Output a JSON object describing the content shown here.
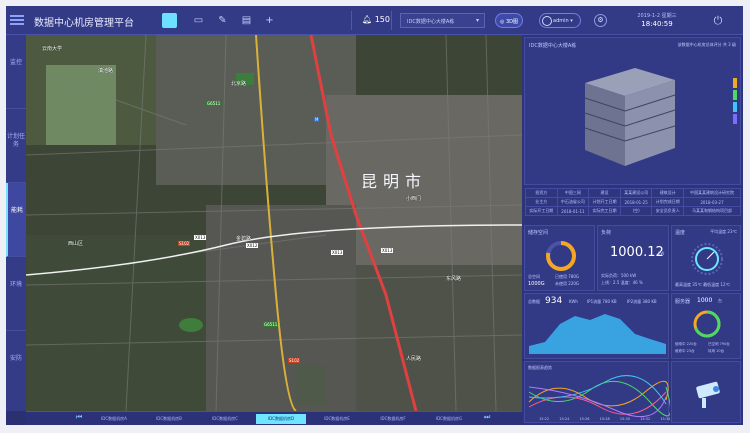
{
  "header": {
    "title": "数据中心机房管理平台",
    "alarm_count": "150",
    "dc_select": "IDC数据中心大楼A栋",
    "pill": "3D图",
    "user": "admin",
    "date": "2019-1-2  星期三",
    "time": "18:40:59"
  },
  "sidenav": [
    {
      "label": "监控"
    },
    {
      "label": "计划任务"
    },
    {
      "label": "能耗"
    },
    {
      "label": "环境"
    },
    {
      "label": "安防"
    }
  ],
  "map": {
    "city": "昆明市",
    "places": [
      "云南大学",
      "滇池路",
      "北京路",
      "金碧路",
      "西山区",
      "小西门",
      "人民路",
      "东风路"
    ],
    "routes": [
      {
        "t": "G6511",
        "c": "g"
      },
      {
        "t": "S102",
        "c": "r"
      },
      {
        "t": "X013",
        "c": "w"
      },
      {
        "t": "X012",
        "c": "w"
      },
      {
        "t": "X013",
        "c": "w"
      },
      {
        "t": "X013",
        "c": "w"
      },
      {
        "t": "G6511",
        "c": "g"
      },
      {
        "t": "S102",
        "c": "r"
      },
      {
        "t": "M",
        "c": "b"
      }
    ]
  },
  "tabs": [
    "IDC数据机房A",
    "IDC数据机房B",
    "IDC数据机房C",
    "IDC数据机房D",
    "IDC数据机房E",
    "IDC数据机房F",
    "IDC数据机房G"
  ],
  "building": {
    "title": "IDC数据中心大楼A栋",
    "sub": "该数据中心机房总体评分 共 3 级"
  },
  "info": [
    [
      "投资方",
      "中国三网",
      "建设",
      "某某建设公司",
      "建筑设计",
      "中国某某建筑设计研究院"
    ],
    [
      "业主方",
      "中石油省公司",
      "计划开工日期",
      "2018-01-25",
      "计划完成日期",
      "2018-03-27"
    ],
    [
      "实际开工日期",
      "2018-01-11",
      "实际完工日期",
      "(空)",
      "安全员负责人",
      "马某某和钢结构项目部"
    ]
  ],
  "storage": {
    "title": "储存空间",
    "used_label": "总空间",
    "used": "1000G",
    "legend": [
      "已使用 780G",
      "未使用 220G"
    ]
  },
  "load": {
    "title": "负荷",
    "value": "1000.12",
    "unit": "kW",
    "lines": [
      "实际负荷：500 kW",
      "上线：2.5  温度：46 %"
    ]
  },
  "temp": {
    "title": "温度",
    "sub": "平均温度 23℃",
    "foot": "最高温度 35℃   最低温度 12℃"
  },
  "traffic": {
    "label": "总数据",
    "value": "934",
    "unit": "KWh",
    "stats": [
      "IP1流量 780 KB",
      "IP2流量 380 KB"
    ]
  },
  "capacity": {
    "title": "服务器",
    "value": "1000",
    "unit": "台",
    "legend": [
      "使用中 220台",
      "已空闲 790台",
      "维修中 23台",
      "待用 10台"
    ]
  },
  "wave": {
    "title": "数据报表趋势",
    "legend": [
      "A",
      "B",
      "C",
      "D",
      "E",
      "F"
    ],
    "x": [
      "15:22",
      "15:24",
      "15:26",
      "15:28",
      "15:30",
      "15:32",
      "15:34"
    ]
  },
  "colors": {
    "accent": "#6ee6ff",
    "ring": "#f5a623",
    "green": "#4cd964"
  }
}
